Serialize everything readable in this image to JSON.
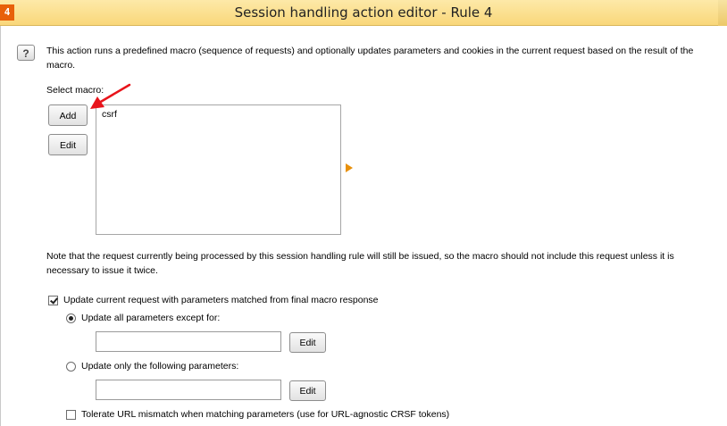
{
  "window": {
    "title": "Session handling action editor - Rule 4",
    "app_icon": "burp-app-icon"
  },
  "description": "This action runs a predefined macro (sequence of requests) and optionally updates parameters and cookies in the current request based on the result of the macro.",
  "macro_section": {
    "label": "Select macro:",
    "add_label": "Add",
    "edit_label": "Edit",
    "items": [
      "csrf"
    ]
  },
  "note": "Note that the request currently being processed by this session handling rule will still be issued, so the macro should not include this request unless it is necessary to issue it twice.",
  "update_current": {
    "label": "Update current request with parameters matched from final macro response",
    "checked": true
  },
  "radio_all": {
    "label": "Update all parameters except for:",
    "selected": true,
    "value": "",
    "edit_label": "Edit"
  },
  "radio_only": {
    "label": "Update only the following parameters:",
    "selected": false,
    "value": "",
    "edit_label": "Edit"
  },
  "tolerate": {
    "label": "Tolerate URL mismatch when matching parameters (use for URL-agnostic CRSF tokens)",
    "checked": false
  },
  "colors": {
    "titlebar": "#f9d77a",
    "accent_arrow": "#e8900a",
    "annotation_arrow": "#e8141b"
  }
}
